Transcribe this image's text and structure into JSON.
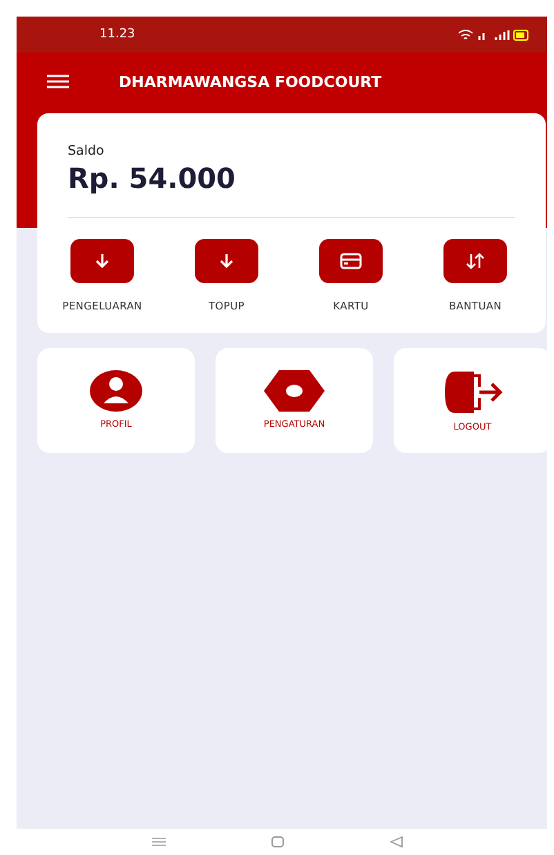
{
  "status_bar": {
    "time": "11.23"
  },
  "app_bar": {
    "title": "DHARMAWANGSA FOODCOURT"
  },
  "balance": {
    "label": "Saldo",
    "amount": "Rp. 54.000"
  },
  "actions": [
    {
      "kind": "down",
      "label": "PENGELUARAN"
    },
    {
      "kind": "down",
      "label": "TOPUP"
    },
    {
      "kind": "card",
      "label": "KARTU"
    },
    {
      "kind": "swap",
      "label": "BANTUAN"
    }
  ],
  "menu": [
    {
      "kind": "profile",
      "label": "PROFIL"
    },
    {
      "kind": "settings",
      "label": "PENGATURAN"
    },
    {
      "kind": "logout",
      "label": "LOGOUT"
    }
  ]
}
